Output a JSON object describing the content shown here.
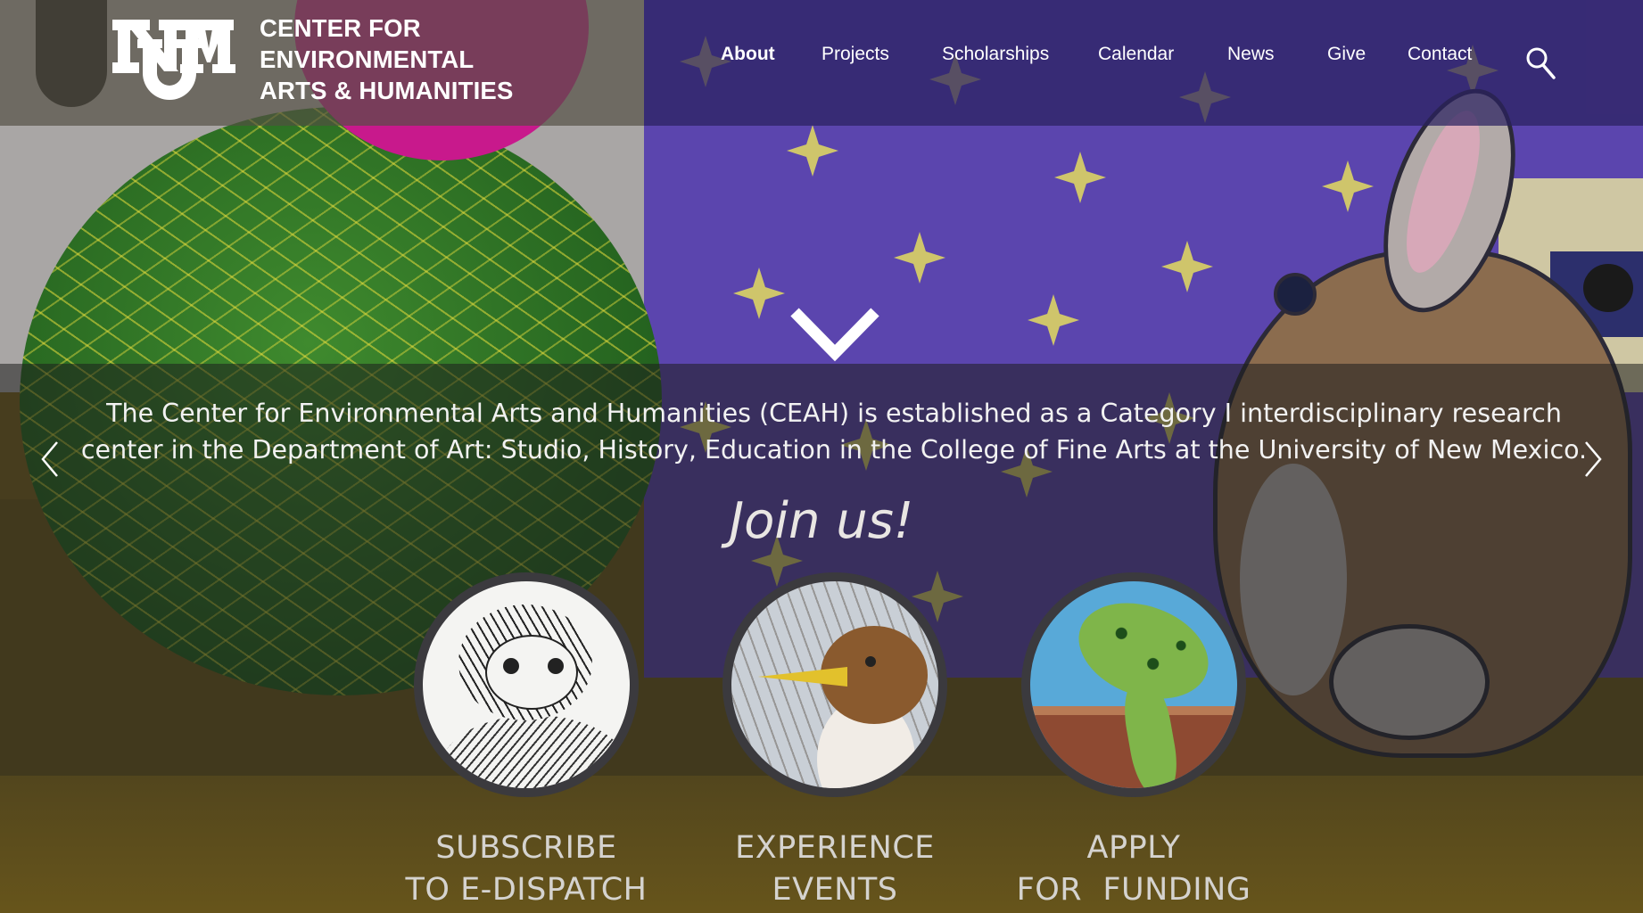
{
  "header": {
    "logo_alt": "UNM",
    "org_lines": [
      "CENTER FOR",
      "ENVIRONMENTAL",
      "ARTS & HUMANITIES"
    ]
  },
  "nav": {
    "items": [
      {
        "label": "About",
        "active": true
      },
      {
        "label": "Projects",
        "active": false
      },
      {
        "label": "Scholarships",
        "active": false
      },
      {
        "label": "Calendar",
        "active": false
      },
      {
        "label": "News",
        "active": false
      },
      {
        "label": "Give",
        "active": false
      },
      {
        "label": "Contact",
        "active": false
      }
    ],
    "search_icon": "search-icon"
  },
  "hero": {
    "intro": "The Center for Environmental Arts and Humanities (CEAH) is established as a Category I interdisciplinary research center in the Department of Art: Studio, History, Education in the College of Fine Arts at the University of New Mexico.",
    "join": "Join us!"
  },
  "cards": [
    {
      "line1": "SUBSCRIBE",
      "line2": "TO E-DISPATCH",
      "image": "otter drawing"
    },
    {
      "line1": "EXPERIENCE",
      "line2": "EVENTS",
      "image": "bird drawing"
    },
    {
      "line1": "APPLY",
      "line2": "FOR  FUNDING",
      "image": "frog drawing"
    }
  ],
  "colors": {
    "header_left": "#524e42",
    "header_right": "#2a215f",
    "text": "#ffffff",
    "cta_text": "#d5d3cf"
  }
}
